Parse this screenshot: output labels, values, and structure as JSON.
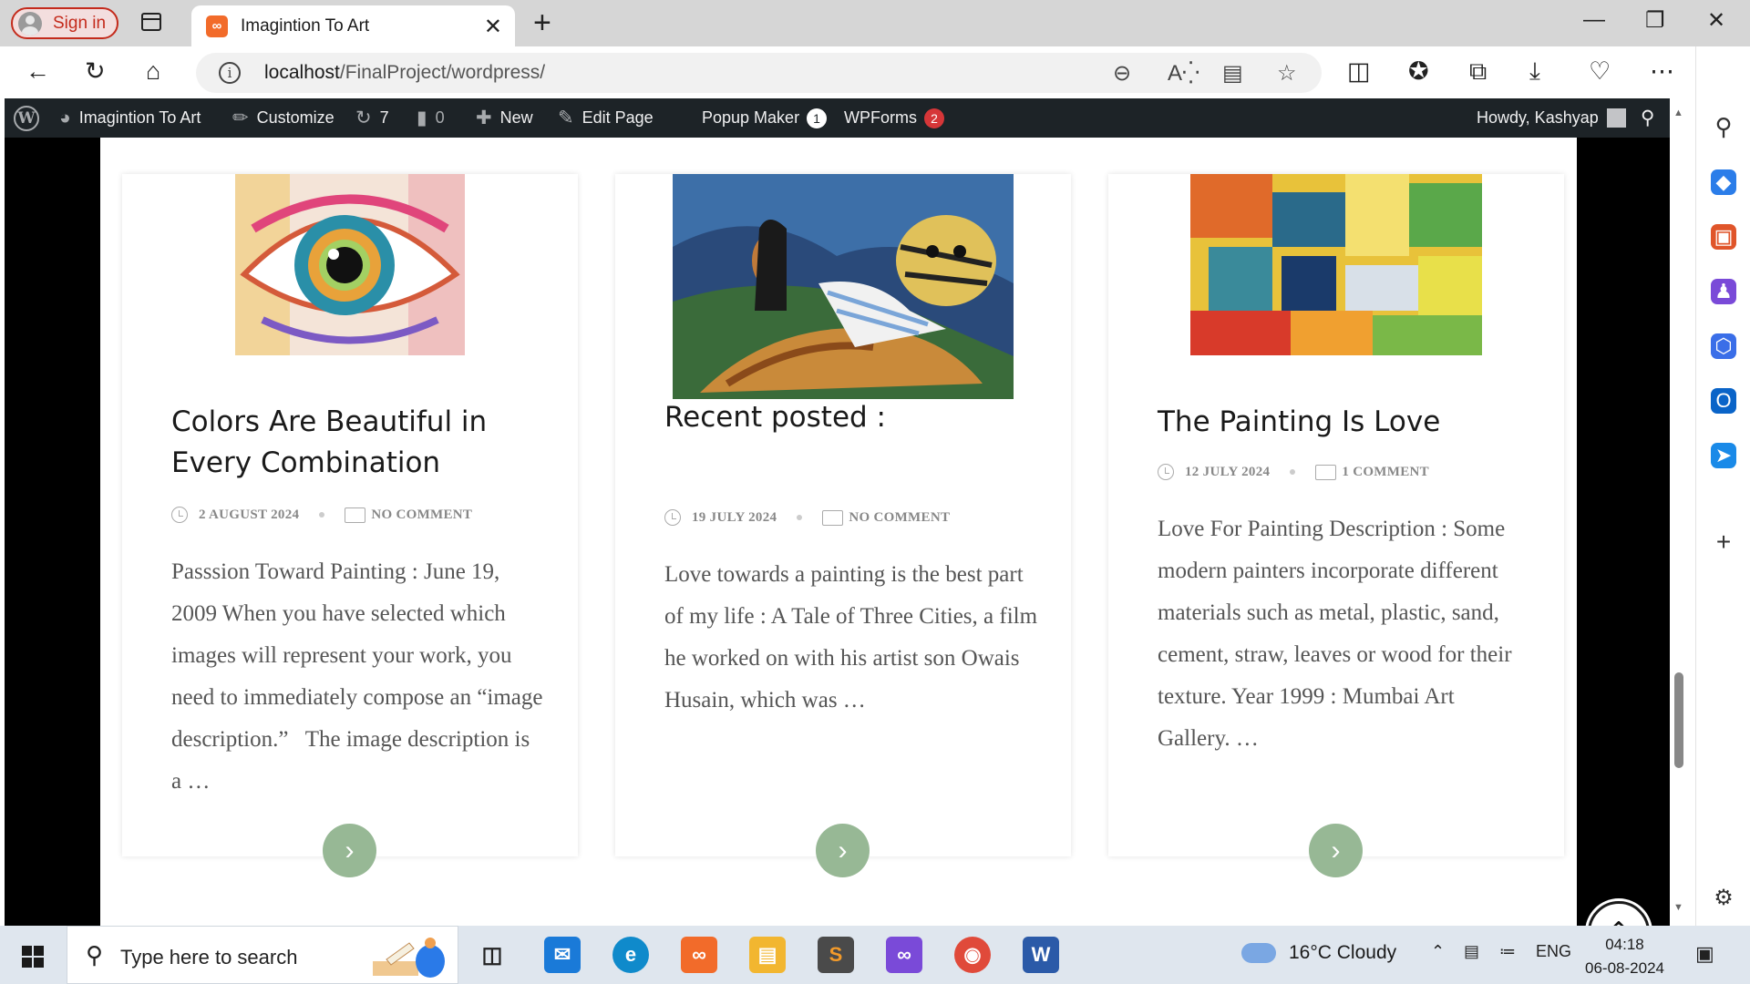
{
  "browser": {
    "sign_in_label": "Sign in",
    "tab_title": "Imagintion To Art",
    "tab_favicon": "xampp-icon",
    "url_host": "localhost",
    "url_path": "/FinalProject/wordpress/"
  },
  "wp_admin_bar": {
    "site_name": "Imagintion To Art",
    "customize_label": "Customize",
    "updates_count": "7",
    "comments_count": "0",
    "new_label": "New",
    "edit_page_label": "Edit Page",
    "popup_maker_label": "Popup Maker",
    "popup_maker_badge": "1",
    "wpforms_label": "WPForms",
    "wpforms_badge": "2",
    "howdy_label": "Howdy, Kashyap"
  },
  "posts": [
    {
      "title": "Colors Are Beautiful in Every Combination",
      "date": "2 AUGUST 2024",
      "comments": "NO COMMENT",
      "excerpt": "Passsion Toward Painting : June 19, 2009 When you have selected which images will represent your work, you need to immediately compose an “image description.”   The image description is a …"
    },
    {
      "title": "Recent posted :",
      "date": "19 JULY 2024",
      "comments": "NO COMMENT",
      "excerpt": "Love towards a painting is the best part of my life : A Tale of Three Cities, a film he worked on with his artist son Owais Husain, which was …"
    },
    {
      "title": "The Painting Is Love",
      "date": "12 JULY 2024",
      "comments": "1 COMMENT",
      "excerpt": "Love For Painting Description : Some modern painters incorporate different materials such as metal, plastic, sand, cement, straw, leaves or wood for their texture. Year 1999 : Mumbai Art Gallery. …"
    }
  ],
  "taskbar": {
    "search_placeholder": "Type here to search",
    "weather": "16°C  Cloudy",
    "language": "ENG",
    "time": "04:18",
    "date": "06-08-2024"
  },
  "colors": {
    "admin_bar_bg": "#1d2327",
    "readmore_button": "#97b895",
    "badge_popup": "#ffffff",
    "badge_wpforms": "#d63638",
    "signin_accent": "#c42b1c"
  }
}
